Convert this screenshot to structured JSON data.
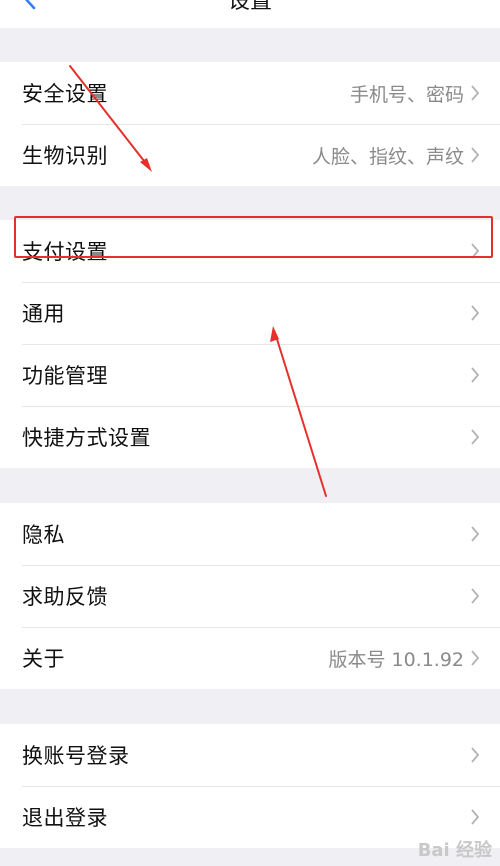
{
  "header": {
    "title": "设置"
  },
  "groups": [
    [
      {
        "label": "安全设置",
        "value": "手机号、密码"
      },
      {
        "label": "生物识别",
        "value": "人脸、指纹、声纹"
      }
    ],
    [
      {
        "label": "支付设置",
        "value": ""
      },
      {
        "label": "通用",
        "value": ""
      },
      {
        "label": "功能管理",
        "value": ""
      },
      {
        "label": "快捷方式设置",
        "value": ""
      }
    ],
    [
      {
        "label": "隐私",
        "value": ""
      },
      {
        "label": "求助反馈",
        "value": ""
      },
      {
        "label": "关于",
        "value": "版本号 10.1.92"
      }
    ],
    [
      {
        "label": "换账号登录",
        "value": ""
      },
      {
        "label": "退出登录",
        "value": ""
      }
    ]
  ],
  "watermark": "Bai 经验",
  "colors": {
    "annotation": "#e5302c",
    "background": "#efeff4",
    "value_text": "#8a8a8a"
  }
}
